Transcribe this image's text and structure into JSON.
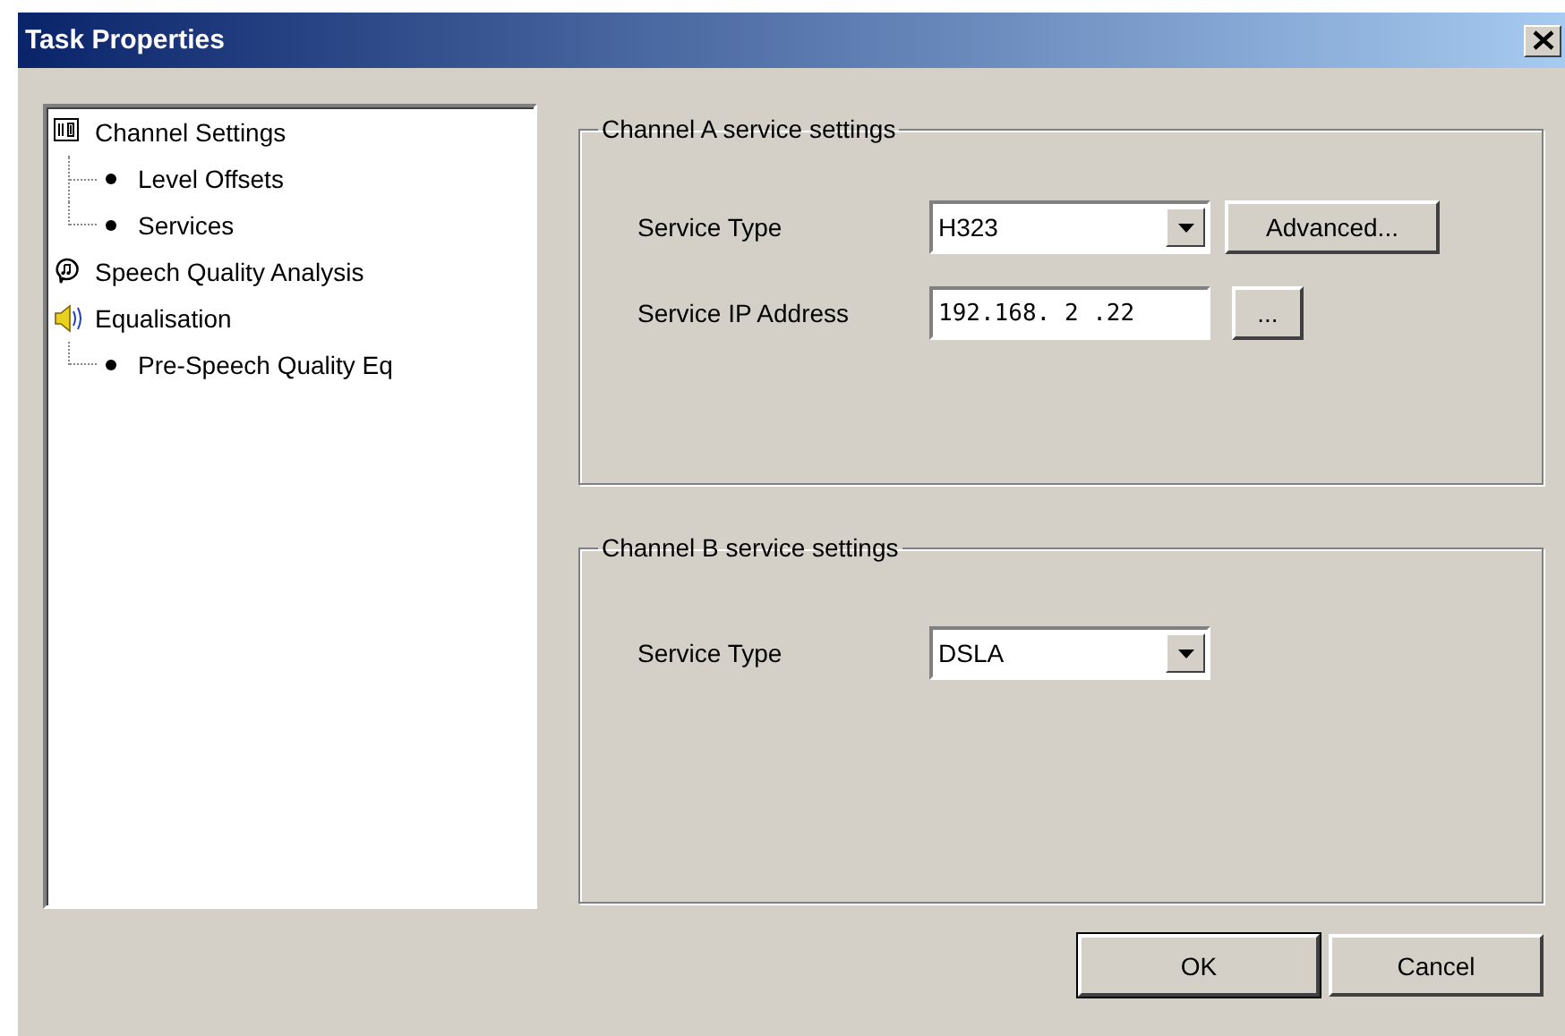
{
  "window": {
    "title": "Task Properties"
  },
  "tree": [
    {
      "label": "Channel Settings",
      "kind": "grid",
      "children": [
        {
          "label": "Level Offsets"
        },
        {
          "label": "Services"
        }
      ]
    },
    {
      "label": "Speech Quality Analysis",
      "kind": "speech"
    },
    {
      "label": "Equalisation",
      "kind": "speaker",
      "children": [
        {
          "label": "Pre-Speech Quality Eq"
        }
      ]
    }
  ],
  "groups": [
    {
      "title": "Channel A service settings",
      "rows": [
        {
          "label": "Service Type",
          "kind": "dropdown",
          "value": "H323",
          "button": "Advanced..."
        },
        {
          "label": "Service IP Address",
          "kind": "ip",
          "value": "192.168. 2 .22",
          "button": "..."
        }
      ]
    },
    {
      "title": "Channel B service settings",
      "rows": [
        {
          "label": "Service Type",
          "kind": "dropdown",
          "value": "DSLA"
        }
      ]
    }
  ],
  "buttons": [
    {
      "label": "OK",
      "default": true
    },
    {
      "label": "Cancel",
      "default": false
    }
  ]
}
